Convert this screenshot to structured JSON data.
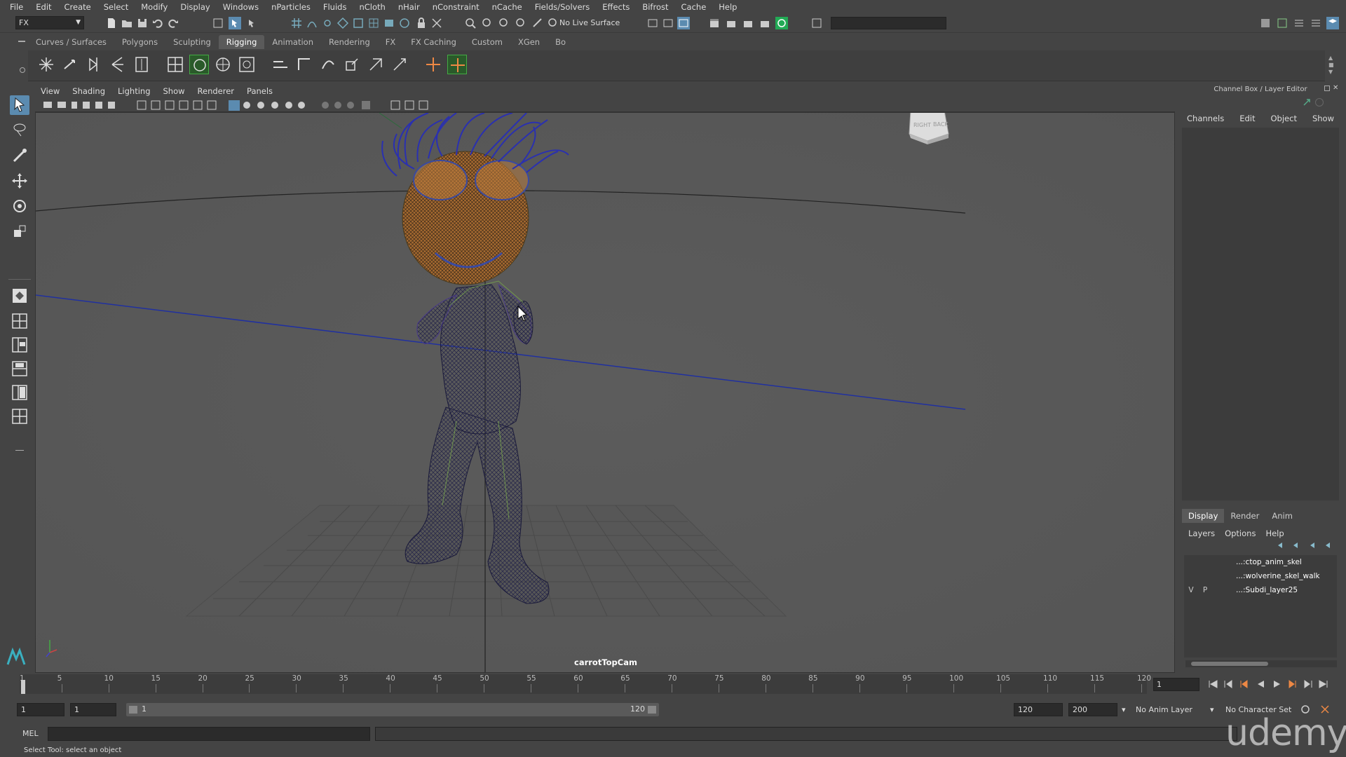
{
  "menubar": {
    "items": [
      "File",
      "Edit",
      "Create",
      "Select",
      "Modify",
      "Display",
      "Windows",
      "nParticles",
      "Fluids",
      "nCloth",
      "nHair",
      "nConstraint",
      "nCache",
      "Fields/Solvers",
      "Effects",
      "Bifrost",
      "Cache",
      "Help"
    ]
  },
  "statusline": {
    "mode": "FX",
    "live_surface": "No Live Surface"
  },
  "shelf": {
    "tabs": [
      "Curves / Surfaces",
      "Polygons",
      "Sculpting",
      "Rigging",
      "Animation",
      "Rendering",
      "FX",
      "FX Caching",
      "Custom",
      "XGen",
      "Bo"
    ],
    "active_tab": "Rigging"
  },
  "viewport": {
    "menus": [
      "View",
      "Shading",
      "Lighting",
      "Show",
      "Renderer",
      "Panels"
    ],
    "camera_label": "carrotTopCam",
    "viewcube_labels": [
      "RIGHT",
      "BACK"
    ]
  },
  "channel_box": {
    "title": "Channel Box / Layer Editor",
    "menus": [
      "Channels",
      "Edit",
      "Object",
      "Show"
    ]
  },
  "layer_editor": {
    "tabs": [
      "Display",
      "Render",
      "Anim"
    ],
    "active_tab": "Display",
    "menus": [
      "Layers",
      "Options",
      "Help"
    ],
    "layers": [
      {
        "v": "",
        "p": "",
        "name": "...:ctop_anim_skel"
      },
      {
        "v": "",
        "p": "",
        "name": "...:wolverine_skel_walk"
      },
      {
        "v": "V",
        "p": "P",
        "name": "...:Subdi_layer25"
      }
    ]
  },
  "timeline": {
    "ticks": [
      "1",
      "5",
      "10",
      "15",
      "20",
      "25",
      "30",
      "35",
      "40",
      "45",
      "50",
      "55",
      "60",
      "65",
      "70",
      "75",
      "80",
      "85",
      "90",
      "95",
      "100",
      "105",
      "110",
      "115",
      "120"
    ],
    "current_frame": "1"
  },
  "range": {
    "start": "1",
    "playback_start": "1",
    "slider_start": "1",
    "slider_end": "120",
    "playback_end": "120",
    "end": "200",
    "anim_layer": "No Anim Layer",
    "character_set": "No Character Set"
  },
  "command_line": {
    "label": "MEL"
  },
  "help_line": "Select Tool: select an object",
  "watermark": "udemy"
}
